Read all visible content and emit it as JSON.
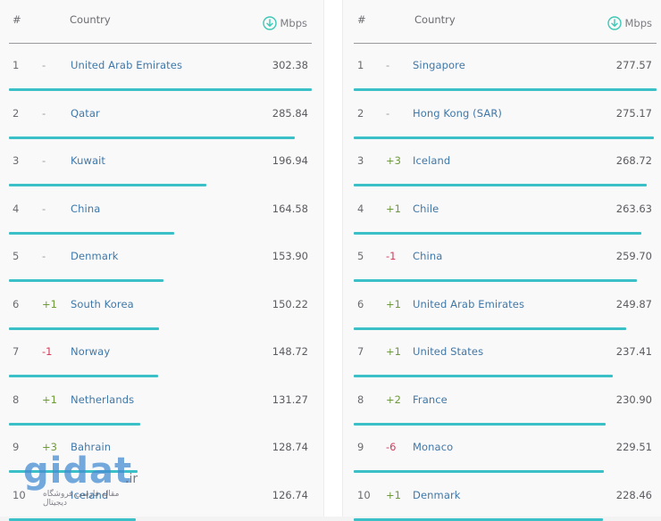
{
  "colors": {
    "bar": "#3cc0c8",
    "country_link": "#3f78a8",
    "change_up": "#6f9a3a",
    "change_down": "#d43c5a",
    "change_neutral": "#9a9aa0",
    "accent_icon": "#3cc8b4"
  },
  "left_table": {
    "headers": {
      "rank": "#",
      "country": "Country",
      "mbps": "Mbps",
      "mbps_icon": "download-arrow-icon"
    },
    "max_value": 302.38,
    "rows": [
      {
        "rank": "1",
        "change": "-",
        "change_type": "neutral",
        "country": "United Arab Emirates",
        "value": "302.38"
      },
      {
        "rank": "2",
        "change": "-",
        "change_type": "neutral",
        "country": "Qatar",
        "value": "285.84"
      },
      {
        "rank": "3",
        "change": "-",
        "change_type": "neutral",
        "country": "Kuwait",
        "value": "196.94"
      },
      {
        "rank": "4",
        "change": "-",
        "change_type": "neutral",
        "country": "China",
        "value": "164.58"
      },
      {
        "rank": "5",
        "change": "-",
        "change_type": "neutral",
        "country": "Denmark",
        "value": "153.90"
      },
      {
        "rank": "6",
        "change": "+1",
        "change_type": "up",
        "country": "South Korea",
        "value": "150.22"
      },
      {
        "rank": "7",
        "change": "-1",
        "change_type": "down",
        "country": "Norway",
        "value": "148.72"
      },
      {
        "rank": "8",
        "change": "+1",
        "change_type": "up",
        "country": "Netherlands",
        "value": "131.27"
      },
      {
        "rank": "9",
        "change": "+3",
        "change_type": "up",
        "country": "Bahrain",
        "value": "128.74"
      },
      {
        "rank": "10",
        "change": "",
        "change_type": "neutral",
        "country": "Iceland",
        "value": "126.74"
      }
    ]
  },
  "right_table": {
    "headers": {
      "rank": "#",
      "country": "Country",
      "mbps": "Mbps",
      "mbps_icon": "download-arrow-icon"
    },
    "max_value": 277.57,
    "rows": [
      {
        "rank": "1",
        "change": "-",
        "change_type": "neutral",
        "country": "Singapore",
        "value": "277.57"
      },
      {
        "rank": "2",
        "change": "-",
        "change_type": "neutral",
        "country": "Hong Kong (SAR)",
        "value": "275.17"
      },
      {
        "rank": "3",
        "change": "+3",
        "change_type": "up",
        "country": "Iceland",
        "value": "268.72"
      },
      {
        "rank": "4",
        "change": "+1",
        "change_type": "up",
        "country": "Chile",
        "value": "263.63"
      },
      {
        "rank": "5",
        "change": "-1",
        "change_type": "down",
        "country": "China",
        "value": "259.70"
      },
      {
        "rank": "6",
        "change": "+1",
        "change_type": "up",
        "country": "United Arab Emirates",
        "value": "249.87"
      },
      {
        "rank": "7",
        "change": "+1",
        "change_type": "up",
        "country": "United States",
        "value": "237.41"
      },
      {
        "rank": "8",
        "change": "+2",
        "change_type": "up",
        "country": "France",
        "value": "230.90"
      },
      {
        "rank": "9",
        "change": "-6",
        "change_type": "down",
        "country": "Monaco",
        "value": "229.51"
      },
      {
        "rank": "10",
        "change": "+1",
        "change_type": "up",
        "country": "Denmark",
        "value": "228.46"
      }
    ]
  },
  "watermark": {
    "brand": "gidat",
    "tld": ".ir",
    "tagline": "مقاله فارسی فروشگاه دیجیتال"
  }
}
